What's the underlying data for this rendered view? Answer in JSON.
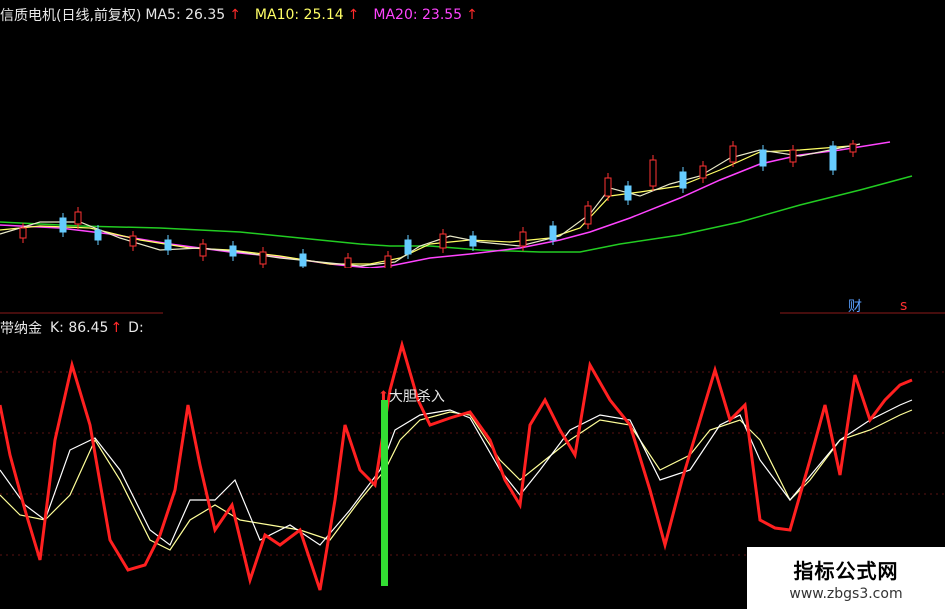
{
  "header": {
    "title": "信质电机(日线,前复权)",
    "ma5_label": "MA5: 26.35",
    "ma10_label": "MA10: 25.14",
    "ma20_label": "MA20: 23.55",
    "up_arrow": "↑"
  },
  "oscillator": {
    "name": "带纳金",
    "k_label": "K: 86.45",
    "d_label": "D:",
    "up_arrow": "↑",
    "signal_label": "大胆杀入"
  },
  "badges": {
    "finance": "财",
    "s_mark": "s"
  },
  "watermark": {
    "title": "指标公式网",
    "url": "www.zbgs3.com"
  },
  "colors": {
    "ma5": "#e9e9c8",
    "ma10": "#ffff66",
    "ma20": "#ff44ff",
    "long_ma": "#22cc22",
    "k_line": "#ff2020",
    "d_line": "#ffffff",
    "j_line": "#ffff99",
    "signal_bar": "#33dd33",
    "up_arrow": "#ff2a2a"
  }
}
